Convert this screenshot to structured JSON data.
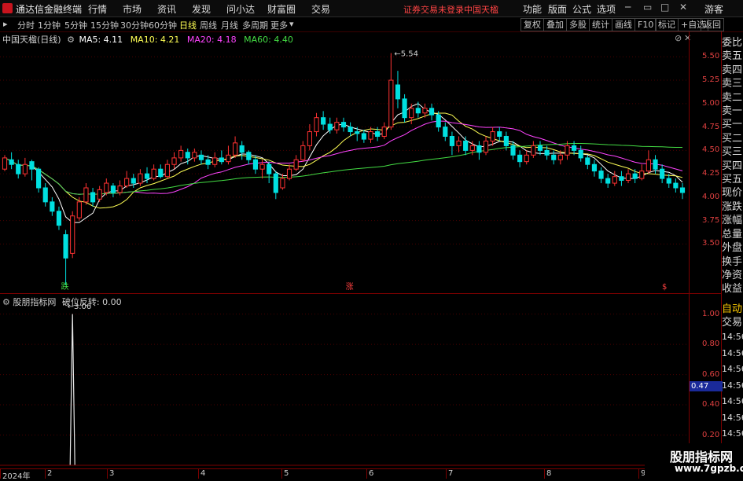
{
  "app": {
    "title": "通达信金融终端",
    "menu": [
      "行情",
      "市场",
      "资讯",
      "发现",
      "问小达",
      "财富圈",
      "交易"
    ],
    "notice": "证券交易未登录",
    "stock_badge": "中国天楹",
    "right_menu": [
      "功能",
      "版面",
      "公式",
      "选项"
    ],
    "guest": "游客"
  },
  "periods": [
    "分时",
    "1分钟",
    "5分钟",
    "15分钟",
    "30分钟",
    "60分钟",
    "日线",
    "周线",
    "月线",
    "多周期",
    "更多"
  ],
  "active_period": "日线",
  "tools": [
    "复权",
    "叠加",
    "多股",
    "统计",
    "画线",
    "F10",
    "标记",
    "+自选",
    "返回"
  ],
  "main": {
    "title": "中国天楹(日线)",
    "ma": [
      {
        "label": "MA5: 4.11",
        "color": "#ffffff"
      },
      {
        "label": "MA10: 4.21",
        "color": "#ffff55"
      },
      {
        "label": "MA20: 4.18",
        "color": "#ff44ff"
      },
      {
        "label": "MA60: 4.40",
        "color": "#44dd44"
      }
    ],
    "high_label": "5.54",
    "low_label": "3.06",
    "markers": [
      "跌",
      "涨",
      "$"
    ],
    "y_ticks": [
      "5.50",
      "5.25",
      "5.00",
      "4.75",
      "4.50",
      "4.25",
      "4.00",
      "3.75",
      "3.50"
    ]
  },
  "sub": {
    "title": "股朋指标网",
    "indicator": "破位反转: 0.00",
    "y_ticks": [
      "1.00",
      "0.80",
      "0.60",
      "0.40",
      "0.20"
    ],
    "current": "0.47"
  },
  "side_labels": [
    "委比",
    "卖五",
    "卖四",
    "卖三",
    "卖二",
    "卖一",
    "买一",
    "买二",
    "买三",
    "买四",
    "买五",
    "现价",
    "涨跌",
    "涨幅",
    "总量",
    "外盘",
    "换手",
    "净资",
    "收益"
  ],
  "side_lower": [
    "自动",
    "交易",
    "14:56",
    "14:56",
    "14:56",
    "14:56",
    "14:56",
    "14:56",
    "14:56",
    "14:56",
    "14:56"
  ],
  "x_labels": [
    "2024年",
    "2",
    "3",
    "4",
    "5",
    "6",
    "7",
    "8",
    "9"
  ],
  "watermark": {
    "line1": "股朋指标网",
    "line2": "www.7gpzb.com"
  },
  "chart_data": {
    "type": "candlestick",
    "ylim": [
      3.0,
      5.62
    ],
    "sub_ylim": [
      0,
      1.05
    ],
    "candles": [
      [
        4.3,
        4.42,
        4.45,
        4.28
      ],
      [
        4.4,
        4.35,
        4.48,
        4.3
      ],
      [
        4.35,
        4.25,
        4.4,
        4.2
      ],
      [
        4.25,
        4.35,
        4.42,
        4.22
      ],
      [
        4.38,
        4.3,
        4.4,
        4.18
      ],
      [
        4.3,
        4.1,
        4.32,
        4.05
      ],
      [
        4.1,
        3.95,
        4.15,
        3.9
      ],
      [
        3.95,
        3.85,
        4.0,
        3.8
      ],
      [
        3.85,
        3.7,
        3.9,
        3.65
      ],
      [
        3.6,
        3.35,
        3.65,
        3.06
      ],
      [
        3.4,
        3.8,
        3.85,
        3.35
      ],
      [
        3.78,
        3.95,
        4.0,
        3.75
      ],
      [
        3.95,
        4.1,
        4.15,
        3.92
      ],
      [
        4.05,
        3.95,
        4.1,
        3.9
      ],
      [
        3.98,
        4.08,
        4.12,
        3.95
      ],
      [
        4.05,
        4.15,
        4.2,
        4.02
      ],
      [
        4.12,
        4.05,
        4.15,
        4.0
      ],
      [
        4.05,
        4.12,
        4.18,
        4.02
      ],
      [
        4.12,
        4.2,
        4.28,
        4.1
      ],
      [
        4.2,
        4.15,
        4.25,
        4.1
      ],
      [
        4.15,
        4.25,
        4.3,
        4.12
      ],
      [
        4.25,
        4.2,
        4.32,
        4.15
      ],
      [
        4.2,
        4.3,
        4.35,
        4.18
      ],
      [
        4.3,
        4.22,
        4.35,
        4.2
      ],
      [
        4.22,
        4.35,
        4.4,
        4.2
      ],
      [
        4.35,
        4.42,
        4.48,
        4.3
      ],
      [
        4.42,
        4.5,
        4.55,
        4.38
      ],
      [
        4.48,
        4.42,
        4.52,
        4.35
      ],
      [
        4.42,
        4.48,
        4.52,
        4.38
      ],
      [
        4.45,
        4.4,
        4.5,
        4.35
      ],
      [
        4.4,
        4.35,
        4.45,
        4.3
      ],
      [
        4.35,
        4.42,
        4.48,
        4.32
      ],
      [
        4.42,
        4.38,
        4.5,
        4.35
      ],
      [
        4.38,
        4.45,
        4.55,
        4.35
      ],
      [
        4.45,
        4.58,
        4.65,
        4.42
      ],
      [
        4.55,
        4.48,
        4.6,
        4.4
      ],
      [
        4.48,
        4.4,
        4.5,
        4.35
      ],
      [
        4.4,
        4.3,
        4.45,
        4.25
      ],
      [
        4.3,
        4.35,
        4.4,
        4.2
      ],
      [
        4.35,
        4.25,
        4.38,
        4.15
      ],
      [
        4.25,
        4.05,
        4.28,
        3.98
      ],
      [
        4.1,
        4.2,
        4.25,
        4.08
      ],
      [
        4.2,
        4.3,
        4.35,
        4.18
      ],
      [
        4.3,
        4.4,
        4.45,
        4.28
      ],
      [
        4.4,
        4.55,
        4.6,
        4.38
      ],
      [
        4.55,
        4.7,
        4.78,
        4.5
      ],
      [
        4.7,
        4.85,
        4.9,
        4.65
      ],
      [
        4.85,
        4.78,
        4.92,
        4.72
      ],
      [
        4.78,
        4.72,
        4.85,
        4.68
      ],
      [
        4.72,
        4.8,
        4.85,
        4.68
      ],
      [
        4.8,
        4.75,
        4.85,
        4.7
      ],
      [
        4.75,
        4.7,
        4.8,
        4.65
      ],
      [
        4.7,
        4.68,
        4.75,
        4.6
      ],
      [
        4.68,
        4.62,
        4.72,
        4.58
      ],
      [
        4.62,
        4.7,
        4.75,
        4.58
      ],
      [
        4.7,
        4.65,
        4.75,
        4.6
      ],
      [
        4.65,
        4.75,
        4.8,
        4.62
      ],
      [
        4.75,
        5.25,
        5.54,
        4.72
      ],
      [
        5.2,
        5.05,
        5.35,
        4.95
      ],
      [
        5.05,
        4.85,
        5.1,
        4.8
      ],
      [
        4.85,
        4.95,
        5.0,
        4.78
      ],
      [
        4.95,
        4.9,
        5.02,
        4.85
      ],
      [
        4.9,
        4.95,
        5.0,
        4.85
      ],
      [
        4.95,
        4.88,
        5.0,
        4.82
      ],
      [
        4.88,
        4.75,
        4.92,
        4.7
      ],
      [
        4.75,
        4.65,
        4.8,
        4.6
      ],
      [
        4.65,
        4.55,
        4.7,
        4.45
      ],
      [
        4.55,
        4.6,
        4.65,
        4.48
      ],
      [
        4.6,
        4.5,
        4.65,
        4.45
      ],
      [
        4.5,
        4.55,
        4.6,
        4.45
      ],
      [
        4.55,
        4.48,
        4.6,
        4.4
      ],
      [
        4.48,
        4.6,
        4.65,
        4.45
      ],
      [
        4.6,
        4.7,
        4.75,
        4.55
      ],
      [
        4.7,
        4.65,
        4.75,
        4.6
      ],
      [
        4.65,
        4.55,
        4.7,
        4.5
      ],
      [
        4.55,
        4.45,
        4.6,
        4.4
      ],
      [
        4.45,
        4.38,
        4.5,
        4.32
      ],
      [
        4.38,
        4.45,
        4.5,
        4.35
      ],
      [
        4.45,
        4.55,
        4.6,
        4.42
      ],
      [
        4.55,
        4.5,
        4.6,
        4.45
      ],
      [
        4.5,
        4.45,
        4.55,
        4.4
      ],
      [
        4.45,
        4.4,
        4.5,
        4.35
      ],
      [
        4.4,
        4.45,
        4.5,
        4.35
      ],
      [
        4.45,
        4.55,
        4.6,
        4.4
      ],
      [
        4.55,
        4.5,
        4.6,
        4.45
      ],
      [
        4.5,
        4.42,
        4.55,
        4.38
      ],
      [
        4.42,
        4.35,
        4.45,
        4.3
      ],
      [
        4.35,
        4.28,
        4.4,
        4.22
      ],
      [
        4.28,
        4.2,
        4.32,
        4.15
      ],
      [
        4.2,
        4.15,
        4.25,
        4.1
      ],
      [
        4.15,
        4.22,
        4.28,
        4.12
      ],
      [
        4.22,
        4.18,
        4.28,
        4.12
      ],
      [
        4.18,
        4.25,
        4.3,
        4.15
      ],
      [
        4.25,
        4.2,
        4.3,
        4.15
      ],
      [
        4.2,
        4.28,
        4.35,
        4.18
      ],
      [
        4.28,
        4.4,
        4.5,
        4.25
      ],
      [
        4.4,
        4.3,
        4.45,
        4.25
      ],
      [
        4.3,
        4.2,
        4.35,
        4.15
      ],
      [
        4.2,
        4.15,
        4.25,
        4.1
      ],
      [
        4.15,
        4.1,
        4.2,
        4.05
      ],
      [
        4.1,
        4.05,
        4.15,
        3.98
      ]
    ],
    "spike_index": 10,
    "spike_value": 1.0
  }
}
